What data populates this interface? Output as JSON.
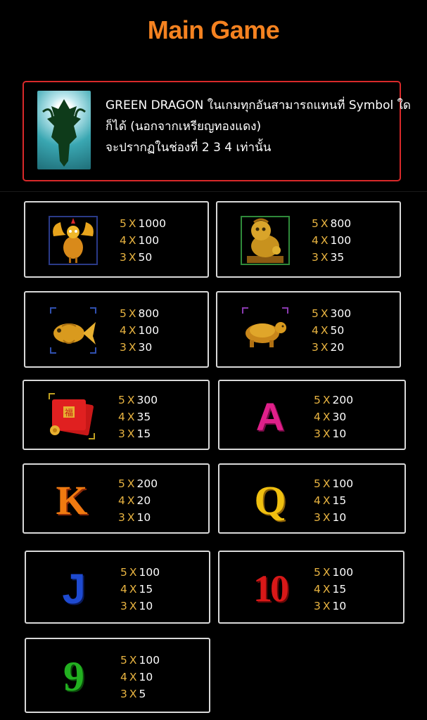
{
  "title": "Main Game",
  "wild": {
    "line1": "GREEN DRAGON ในเกมทุกอันสามารถแทนที่ Symbol ใด",
    "line2": "ก็ได้ (นอกจากเหรียญทองแดง)",
    "line3": "จะปรากฏในช่องที่ 2 3 4 เท่านั้น"
  },
  "symbols": [
    {
      "name": "golden-phoenix-icon",
      "pays": [
        {
          "n": "5",
          "v": "1000"
        },
        {
          "n": "4",
          "v": "100"
        },
        {
          "n": "3",
          "v": "50"
        }
      ]
    },
    {
      "name": "golden-lion-icon",
      "pays": [
        {
          "n": "5",
          "v": "800"
        },
        {
          "n": "4",
          "v": "100"
        },
        {
          "n": "3",
          "v": "35"
        }
      ]
    },
    {
      "name": "golden-koi-fish-icon",
      "pays": [
        {
          "n": "5",
          "v": "800"
        },
        {
          "n": "4",
          "v": "100"
        },
        {
          "n": "3",
          "v": "30"
        }
      ]
    },
    {
      "name": "golden-turtle-icon",
      "pays": [
        {
          "n": "5",
          "v": "300"
        },
        {
          "n": "4",
          "v": "50"
        },
        {
          "n": "3",
          "v": "20"
        }
      ]
    },
    {
      "name": "red-envelope-icon",
      "pays": [
        {
          "n": "5",
          "v": "300"
        },
        {
          "n": "4",
          "v": "35"
        },
        {
          "n": "3",
          "v": "15"
        }
      ]
    },
    {
      "name": "letter-a-icon",
      "glyph": "A",
      "pays": [
        {
          "n": "5",
          "v": "200"
        },
        {
          "n": "4",
          "v": "30"
        },
        {
          "n": "3",
          "v": "10"
        }
      ]
    },
    {
      "name": "letter-k-icon",
      "glyph": "K",
      "pays": [
        {
          "n": "5",
          "v": "200"
        },
        {
          "n": "4",
          "v": "20"
        },
        {
          "n": "3",
          "v": "10"
        }
      ]
    },
    {
      "name": "letter-q-icon",
      "glyph": "Q",
      "pays": [
        {
          "n": "5",
          "v": "100"
        },
        {
          "n": "4",
          "v": "15"
        },
        {
          "n": "3",
          "v": "10"
        }
      ]
    },
    {
      "name": "letter-j-icon",
      "glyph": "J",
      "pays": [
        {
          "n": "5",
          "v": "100"
        },
        {
          "n": "4",
          "v": "15"
        },
        {
          "n": "3",
          "v": "10"
        }
      ]
    },
    {
      "name": "number-10-icon",
      "glyph": "10",
      "pays": [
        {
          "n": "5",
          "v": "100"
        },
        {
          "n": "4",
          "v": "15"
        },
        {
          "n": "3",
          "v": "10"
        }
      ]
    },
    {
      "name": "number-9-icon",
      "glyph": "9",
      "pays": [
        {
          "n": "5",
          "v": "100"
        },
        {
          "n": "4",
          "v": "10"
        },
        {
          "n": "3",
          "v": "5"
        }
      ]
    }
  ],
  "multiplier": "X",
  "colors": {
    "title": "#f58220",
    "wild_border": "#d9292a",
    "pay_count": "#e9b441",
    "card_border": "#d9d9d9"
  }
}
